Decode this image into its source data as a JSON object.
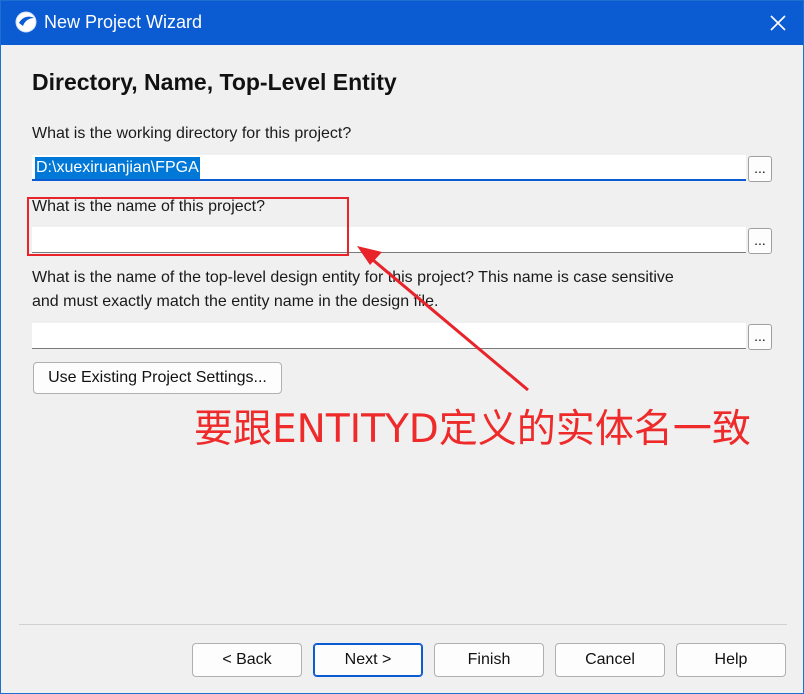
{
  "window": {
    "title": "New Project Wizard",
    "icon": "quartus-icon",
    "close_icon": "close-icon"
  },
  "page": {
    "heading": "Directory, Name, Top-Level Entity",
    "directory_label": "What is the working directory for this project?",
    "directory_value": "D:\\xuexiruanjian\\FPGA",
    "name_label": "What is the name of this project?",
    "name_value": "",
    "entity_label_line1": "What is the name of the top-level design entity for this project? This name is case sensitive",
    "entity_label_line2": "and must exactly match the entity name in the design file.",
    "entity_value": "",
    "browse_label": "...",
    "use_existing_label": "Use Existing Project Settings..."
  },
  "buttons": {
    "back": "< Back",
    "next": "Next >",
    "finish": "Finish",
    "cancel": "Cancel",
    "help": "Help"
  },
  "annotation": {
    "text": "要跟ENTITYD定义的实体名一致",
    "color": "#e8232a"
  },
  "colors": {
    "titlebar": "#0b5bd3",
    "selection": "#0078d7"
  }
}
